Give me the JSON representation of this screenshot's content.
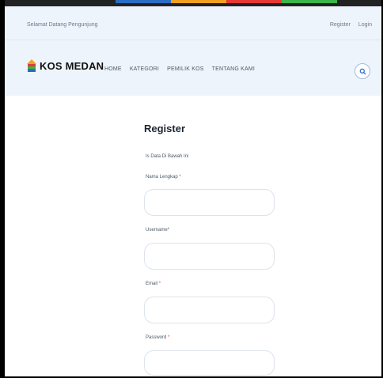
{
  "topbar": {
    "welcome": "Selamat Datang Pengunjung",
    "register": "Register",
    "login": "Login"
  },
  "brand": {
    "name": "KOS MEDAN"
  },
  "nav": {
    "items": [
      "HOME",
      "KATEGORI",
      "PEMILIK KOS",
      "TENTANG KAMI"
    ]
  },
  "form": {
    "title": "Register",
    "subtitle": "Is Data Di Bawah Ini",
    "fields": [
      {
        "label": "Nama Lengkap",
        "required": "*"
      },
      {
        "label": "Username",
        "required": "*"
      },
      {
        "label": "Email",
        "required": "*"
      },
      {
        "label": "Password",
        "required": "*"
      }
    ]
  },
  "colors": {
    "header_bg": "#eef4fb",
    "accent_blue": "#2f6fd0",
    "required": "#e53935",
    "strip_blue": "#2b6cc4",
    "strip_orange": "#f2a01d",
    "strip_red": "#e53935",
    "strip_green": "#3bb54a"
  },
  "icons": {
    "search": "search-icon",
    "logo": "house-logo-icon"
  }
}
